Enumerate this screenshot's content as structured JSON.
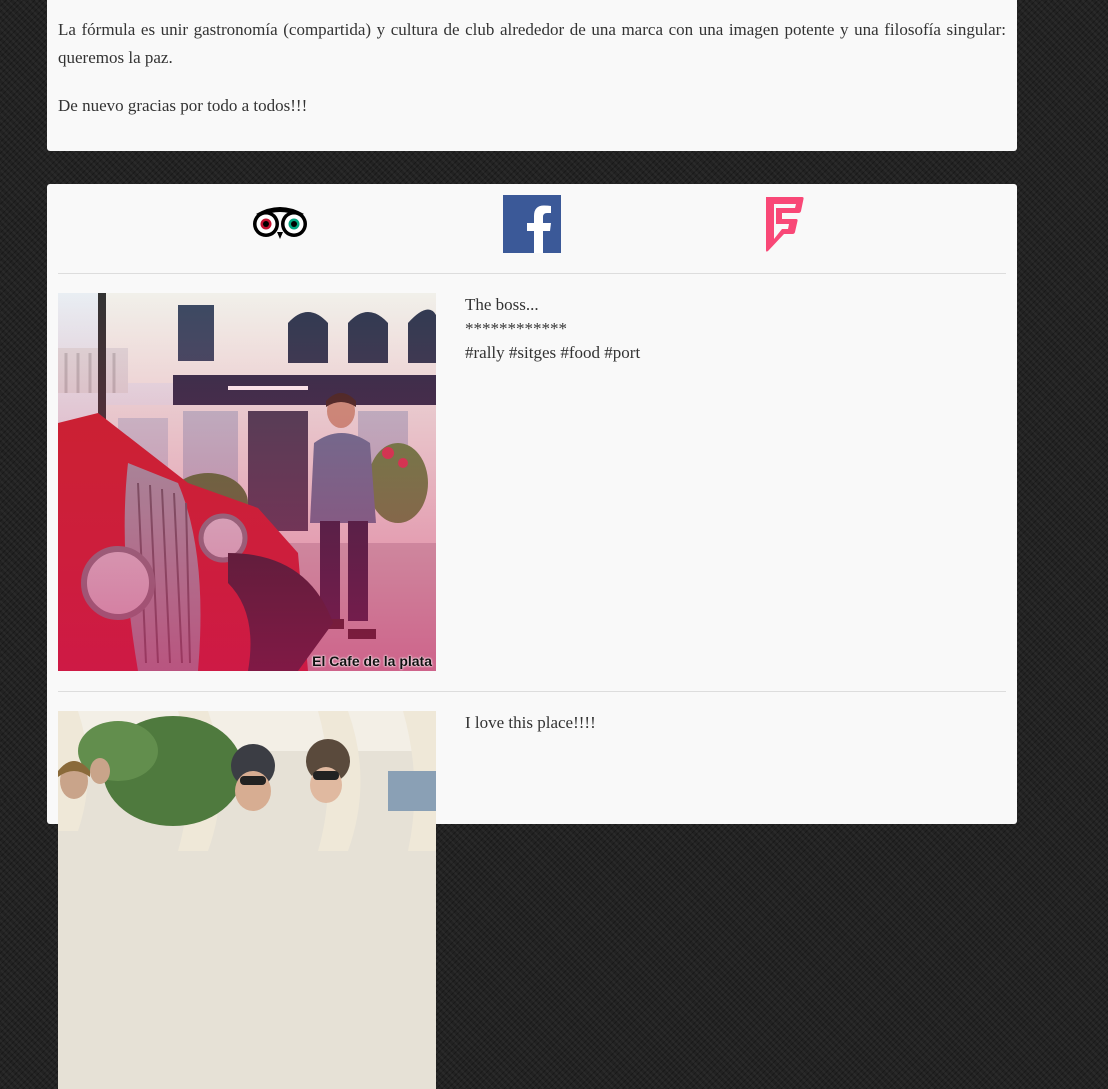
{
  "intro": {
    "paragraph1": "La fórmula es unir gastronomía (compartida) y cultura de club alrededor de una marca con una imagen potente y una filosofía singular: queremos la paz.",
    "paragraph2": "De nuevo gracias por todo a todos!!!"
  },
  "social": {
    "icons": [
      "tripadvisor-icon",
      "facebook-icon",
      "foursquare-icon"
    ],
    "colors": {
      "facebook": "#3b5998",
      "foursquare": "#f94877",
      "tripadvisor": "#000000"
    }
  },
  "posts": [
    {
      "lines": [
        "The boss...",
        "************",
        "#rally #sitges #food #port"
      ],
      "image_caption": "El Cafe de la plata"
    },
    {
      "lines": [
        "I love this place!!!!"
      ]
    }
  ]
}
